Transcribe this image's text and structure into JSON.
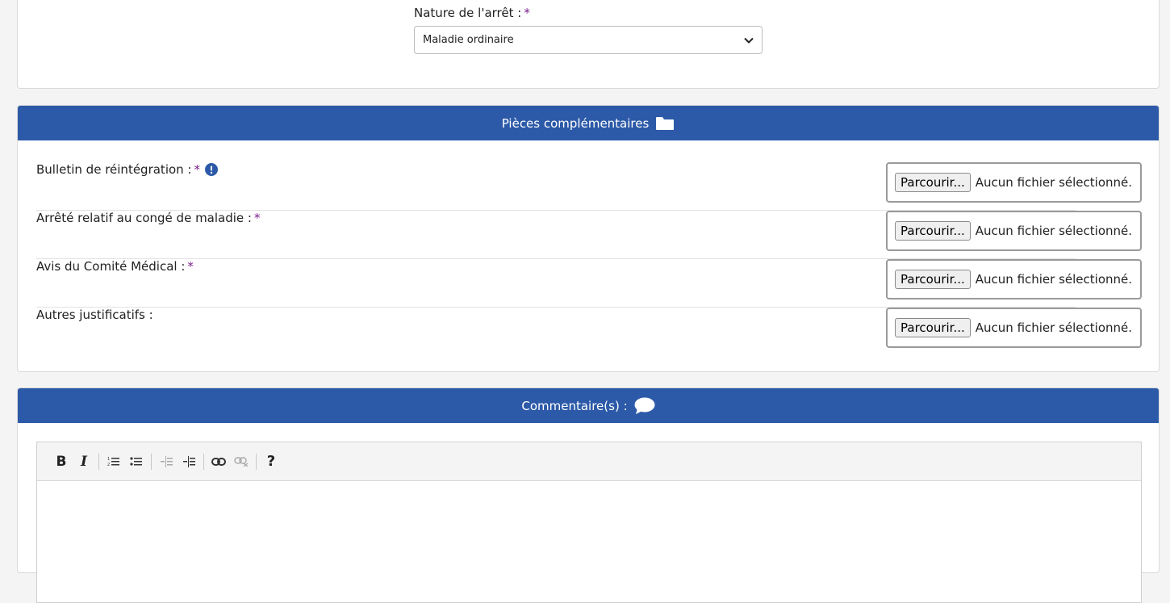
{
  "nature": {
    "label": "Nature de l'arrêt :",
    "required_mark": "*",
    "selected": "Maladie ordinaire"
  },
  "pieces": {
    "title": "Pièces complémentaires",
    "rows": [
      {
        "label": "Bulletin de réintégration :",
        "required": "*",
        "browse": "Parcourir...",
        "status": "Aucun fichier sélectionné."
      },
      {
        "label": "Arrêté relatif au congé de maladie :",
        "required": "*",
        "browse": "Parcourir...",
        "status": "Aucun fichier sélectionné."
      },
      {
        "label": "Avis du Comité Médical :",
        "required": "*",
        "browse": "Parcourir...",
        "status": "Aucun fichier sélectionné."
      },
      {
        "label": "Autres justificatifs :",
        "required": "",
        "browse": "Parcourir...",
        "status": "Aucun fichier sélectionné."
      }
    ]
  },
  "comments": {
    "title": "Commentaire(s) :",
    "toolbar": {
      "bold": "B",
      "italic": "I",
      "help": "?"
    }
  },
  "colors": {
    "header": "#2c5aa8",
    "required": "#7a1f8a",
    "info": "#2c5aa8"
  },
  "icons": [
    "folder-icon",
    "info-icon",
    "chevron-down-icon",
    "speech-bubble-icon"
  ]
}
